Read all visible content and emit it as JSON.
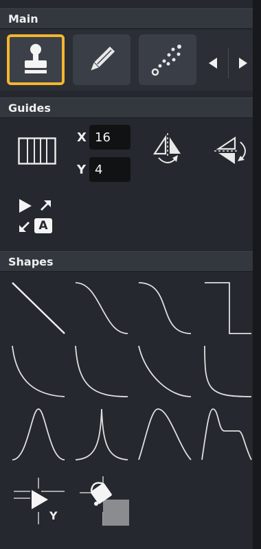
{
  "sections": {
    "main": {
      "title": "Main"
    },
    "guides": {
      "title": "Guides"
    },
    "shapes": {
      "title": "Shapes"
    }
  },
  "main": {
    "tabs": [
      {
        "icon": "stamp-icon",
        "selected": true
      },
      {
        "icon": "pencil-icon",
        "selected": false
      },
      {
        "icon": "scatter-points-icon",
        "selected": false
      }
    ],
    "scroll_left_icon": "triangle-left-icon",
    "scroll_right_icon": "triangle-right-icon"
  },
  "guides": {
    "grid_icon": "vertical-grid-icon",
    "x_label": "X",
    "x_value": "16",
    "y_label": "Y",
    "y_value": "4",
    "flip_horizontal_icon": "flip-horizontal-icon",
    "flip_vertical_icon": "flip-vertical-icon",
    "auto_align_icon": "cursor-expand-auto-icon",
    "auto_align_letter": "A"
  },
  "shapes": {
    "curves": [
      "linear-curve-icon",
      "s-curve-gentle-icon",
      "s-curve-steep-icon",
      "step-curve-icon",
      "concave-curve-icon",
      "concave-soft-curve-icon",
      "concave-deep-curve-icon",
      "sharp-elbow-curve-icon",
      "bell-curve-icon",
      "spike-curve-icon",
      "skewed-peak-curve-icon",
      "peak-plateau-curve-icon"
    ],
    "tools": {
      "y_guide_icon": "y-guide-cursor-icon",
      "y_guide_letter": "Y",
      "fill_icon": "paint-bucket-fill-icon"
    }
  },
  "colors": {
    "selection": "#f2b62f",
    "panel_bg": "#25282e",
    "header_bg": "#33373e",
    "input_bg": "#111214",
    "icon": "#e8e8e8"
  }
}
